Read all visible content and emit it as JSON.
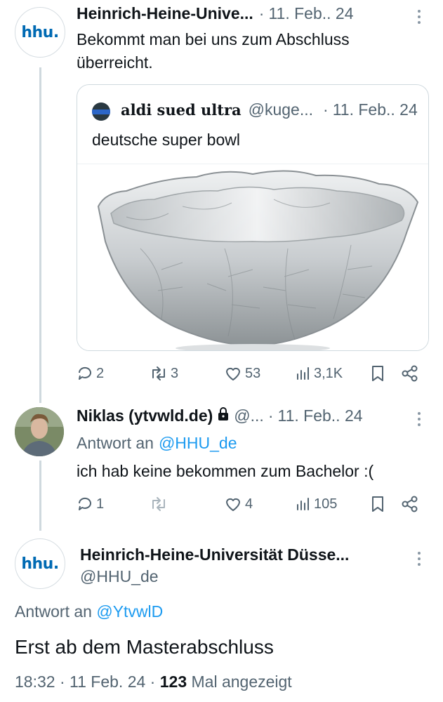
{
  "tweet1": {
    "avatar_logo": "hhu.",
    "name": "Heinrich-Heine-Unive...",
    "separator": "·",
    "date": "11. Feb.. 24",
    "text_line1": "Bekommt man bei uns zum Abschluss",
    "text_line2": "überreicht.",
    "quote": {
      "name": "aldi sued ultra",
      "handle": "@kuge...",
      "separator": "·",
      "date": "11. Feb.. 24",
      "text": "deutsche super bowl",
      "image_icon": "glass-bowl-image"
    },
    "actions": {
      "replies": "2",
      "retweets": "3",
      "likes": "53",
      "views": "3,1K"
    }
  },
  "tweet2": {
    "name": "Niklas (ytvwld.de)",
    "handle": "@...",
    "separator": "·",
    "date": "11. Feb.. 24",
    "reply_prefix": "Antwort an",
    "reply_handle": "@HHU_de",
    "text": "ich hab keine bekommen zum Bachelor :(",
    "actions": {
      "replies": "1",
      "retweets": "",
      "likes": "4",
      "views": "105"
    }
  },
  "main_tweet": {
    "avatar_logo": "hhu.",
    "name": "Heinrich-Heine-Universität Düsse...",
    "handle": "@HHU_de",
    "reply_prefix": "Antwort an",
    "reply_handle": "@YtvwlD",
    "text": "Erst ab dem Masterabschluss",
    "time": "18:32",
    "dot1": "·",
    "date": "11 Feb. 24",
    "dot2": "·",
    "views_count": "123",
    "views_label": "Mal angezeigt"
  },
  "colors": {
    "accent": "#1d9bf0",
    "muted": "#536471",
    "brand_hhu": "#006ab3",
    "text": "#0f1419",
    "border": "#cfd9de"
  }
}
